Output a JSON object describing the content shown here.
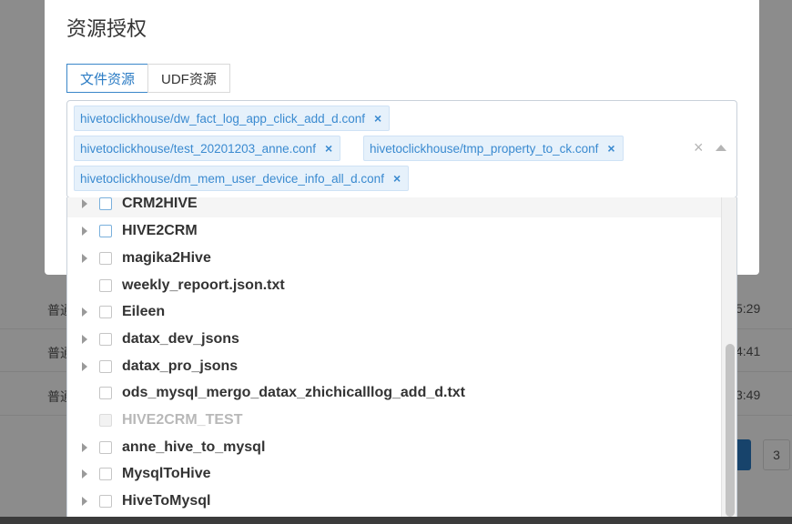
{
  "background": {
    "rows": [
      {
        "col1": "普通",
        "time": "5:29"
      },
      {
        "col1": "普通",
        "time": "4:41"
      },
      {
        "col1": "普通",
        "time": "3:49"
      }
    ],
    "pager": {
      "next_page": "3"
    }
  },
  "modal": {
    "title": "资源授权",
    "tabs": [
      {
        "label": "文件资源",
        "active": true
      },
      {
        "label": "UDF资源",
        "active": false
      }
    ]
  },
  "selected_tags": [
    "hivetoclickhouse/dw_fact_log_app_click_add_d.conf",
    "hivetoclickhouse/test_20201203_anne.conf",
    "hivetoclickhouse/tmp_property_to_ck.conf",
    "hivetoclickhouse/dm_mem_user_device_info_all_d.conf"
  ],
  "tree": [
    {
      "label": "CRM2HIVE",
      "expandable": true,
      "disabled": false
    },
    {
      "label": "HIVE2CRM",
      "expandable": true,
      "disabled": false
    },
    {
      "label": "magika2Hive",
      "expandable": true,
      "disabled": false
    },
    {
      "label": "weekly_repoort.json.txt",
      "expandable": false,
      "disabled": false
    },
    {
      "label": "Eileen",
      "expandable": true,
      "disabled": false
    },
    {
      "label": "datax_dev_jsons",
      "expandable": true,
      "disabled": false
    },
    {
      "label": "datax_pro_jsons",
      "expandable": true,
      "disabled": false
    },
    {
      "label": "ods_mysql_mergo_datax_zhichicalllog_add_d.txt",
      "expandable": false,
      "disabled": false
    },
    {
      "label": "HIVE2CRM_TEST",
      "expandable": false,
      "disabled": true
    },
    {
      "label": "anne_hive_to_mysql",
      "expandable": true,
      "disabled": false
    },
    {
      "label": "MysqlToHive",
      "expandable": true,
      "disabled": false
    },
    {
      "label": "HiveToMysql",
      "expandable": true,
      "disabled": false
    }
  ],
  "colors": {
    "accent": "#2a7bc4",
    "tag_bg": "#e6f1fb",
    "tag_text": "#3a8ad0"
  }
}
